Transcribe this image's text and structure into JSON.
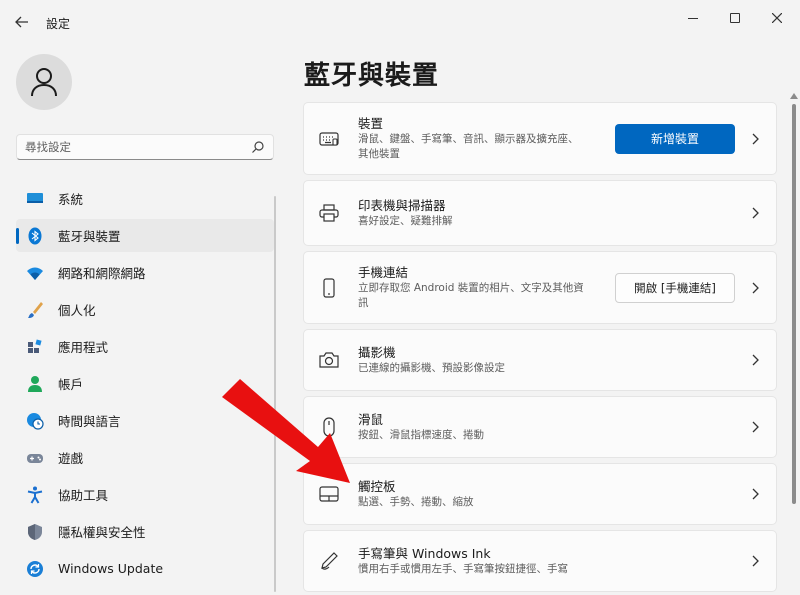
{
  "window": {
    "title": "設定"
  },
  "search": {
    "placeholder": "尋找設定"
  },
  "sidebar": {
    "items": [
      {
        "label": "系統",
        "icon": "monitor-icon"
      },
      {
        "label": "藍牙與裝置",
        "icon": "bluetooth-icon",
        "selected": true
      },
      {
        "label": "網路和網際網路",
        "icon": "wifi-icon"
      },
      {
        "label": "個人化",
        "icon": "brush-icon"
      },
      {
        "label": "應用程式",
        "icon": "apps-icon"
      },
      {
        "label": "帳戶",
        "icon": "person-icon"
      },
      {
        "label": "時間與語言",
        "icon": "globe-clock-icon"
      },
      {
        "label": "遊戲",
        "icon": "gamepad-icon"
      },
      {
        "label": "協助工具",
        "icon": "accessibility-icon"
      },
      {
        "label": "隱私權與安全性",
        "icon": "shield-icon"
      },
      {
        "label": "Windows Update",
        "icon": "update-icon"
      }
    ]
  },
  "main": {
    "title": "藍牙與裝置",
    "cards": [
      {
        "title": "裝置",
        "desc1": "滑鼠、鍵盤、手寫筆、音訊、顯示器及擴充座、",
        "desc2": "其他裝置",
        "button": "新增裝置",
        "icon": "devices-icon"
      },
      {
        "title": "印表機與掃描器",
        "desc1": "喜好設定、疑難排解",
        "icon": "printer-icon"
      },
      {
        "title": "手機連結",
        "desc1": "立即存取您 Android 裝置的相片、文字及其他資",
        "desc2": "訊",
        "button": "開啟 [手機連結]",
        "icon": "phone-icon"
      },
      {
        "title": "攝影機",
        "desc1": "已連線的攝影機、預設影像設定",
        "icon": "camera-icon"
      },
      {
        "title": "滑鼠",
        "desc1": "按鈕、滑鼠指標速度、捲動",
        "icon": "mouse-icon"
      },
      {
        "title": "觸控板",
        "desc1": "點選、手勢、捲動、縮放",
        "icon": "touchpad-icon"
      },
      {
        "title": "手寫筆與 Windows Ink",
        "desc1": "慣用右手或慣用左手、手寫筆按鈕捷徑、手寫",
        "icon": "pen-icon"
      }
    ]
  },
  "colors": {
    "accent": "#0067c0",
    "annotation_arrow": "#e81010"
  }
}
